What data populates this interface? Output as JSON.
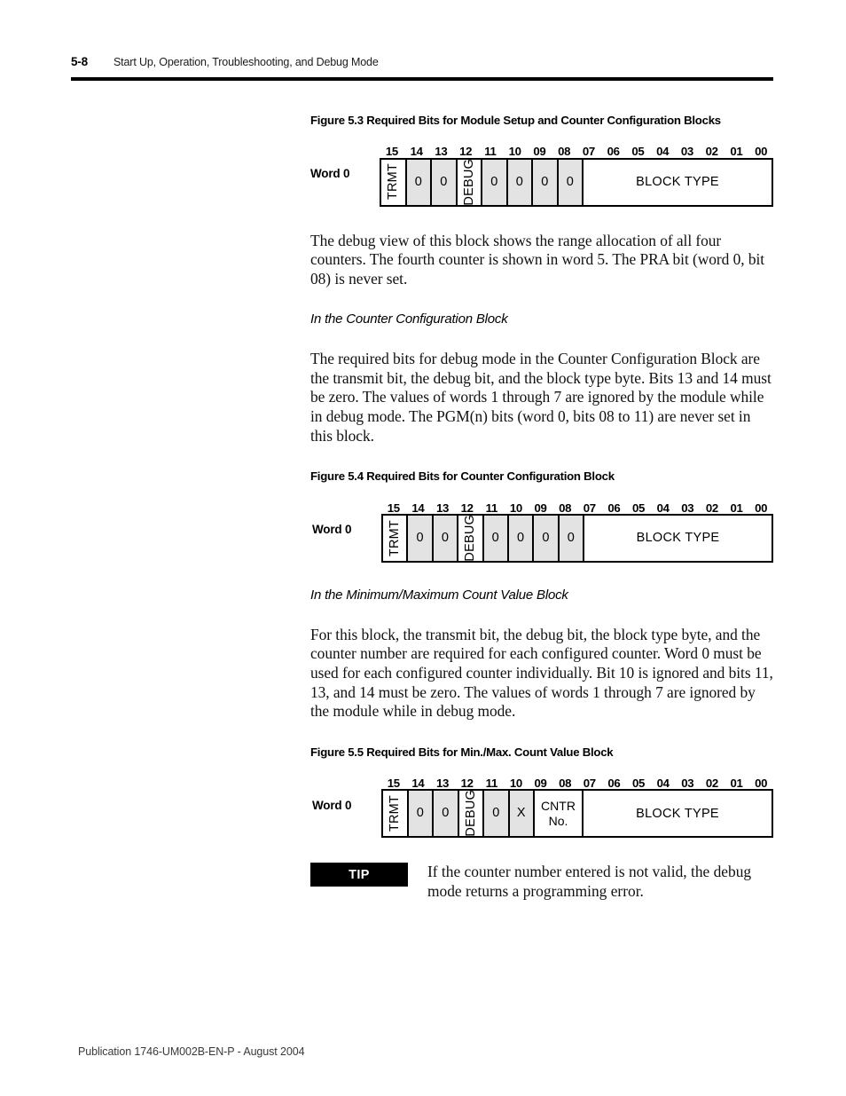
{
  "page": {
    "folio": "5-8",
    "header_title": "Start Up, Operation, Troubleshooting, and Debug Mode",
    "footer": "Publication 1746-UM002B-EN-P - August 2004"
  },
  "bit_labels": [
    "15",
    "14",
    "13",
    "12",
    "11",
    "10",
    "09",
    "08",
    "07",
    "06",
    "05",
    "04",
    "03",
    "02",
    "01",
    "00"
  ],
  "figures": {
    "f53": {
      "caption": "Figure 5.3 Required Bits for Module Setup and Counter Configuration Blocks",
      "word_label": "Word 0",
      "cells": [
        {
          "text": "TRMT",
          "style": "vert",
          "shaded": false,
          "span": 1
        },
        {
          "text": "0",
          "style": "flat",
          "shaded": true,
          "span": 1
        },
        {
          "text": "0",
          "style": "flat",
          "shaded": true,
          "span": 1
        },
        {
          "text": "DEBUG",
          "style": "vert",
          "shaded": false,
          "span": 1
        },
        {
          "text": "0",
          "style": "flat",
          "shaded": true,
          "span": 1
        },
        {
          "text": "0",
          "style": "flat",
          "shaded": true,
          "span": 1
        },
        {
          "text": "0",
          "style": "flat",
          "shaded": true,
          "span": 1
        },
        {
          "text": "0",
          "style": "flat",
          "shaded": true,
          "span": 1
        },
        {
          "text": "BLOCK TYPE",
          "style": "wide",
          "shaded": false,
          "span": 8
        }
      ]
    },
    "f54": {
      "caption": "Figure 5.4 Required Bits for Counter Configuration Block",
      "word_label": "Word 0",
      "cells": [
        {
          "text": "TRMT",
          "style": "vert",
          "shaded": false,
          "span": 1
        },
        {
          "text": "0",
          "style": "flat",
          "shaded": true,
          "span": 1
        },
        {
          "text": "0",
          "style": "flat",
          "shaded": true,
          "span": 1
        },
        {
          "text": "DEBUG",
          "style": "vert",
          "shaded": false,
          "span": 1
        },
        {
          "text": "0",
          "style": "flat",
          "shaded": true,
          "span": 1
        },
        {
          "text": "0",
          "style": "flat",
          "shaded": true,
          "span": 1
        },
        {
          "text": "0",
          "style": "flat",
          "shaded": true,
          "span": 1
        },
        {
          "text": "0",
          "style": "flat",
          "shaded": true,
          "span": 1
        },
        {
          "text": "BLOCK TYPE",
          "style": "wide",
          "shaded": false,
          "span": 8
        }
      ]
    },
    "f55": {
      "caption": "Figure 5.5 Required Bits for Min./Max. Count Value Block",
      "word_label": "Word 0",
      "cells": [
        {
          "text": "TRMT",
          "style": "vert",
          "shaded": false,
          "span": 1
        },
        {
          "text": "0",
          "style": "flat",
          "shaded": true,
          "span": 1
        },
        {
          "text": "0",
          "style": "flat",
          "shaded": true,
          "span": 1
        },
        {
          "text": "DEBUG",
          "style": "vert",
          "shaded": false,
          "span": 1
        },
        {
          "text": "0",
          "style": "flat",
          "shaded": true,
          "span": 1
        },
        {
          "text": "X",
          "style": "flat",
          "shaded": true,
          "span": 1
        },
        {
          "text": "CNTR\nNo.",
          "style": "two-line",
          "shaded": false,
          "span": 2
        },
        {
          "text": "BLOCK TYPE",
          "style": "wide",
          "shaded": false,
          "span": 8
        }
      ]
    }
  },
  "body": {
    "p1": "The debug view of this block shows the range allocation of all four counters. The fourth counter is shown in word 5. The PRA bit (word 0, bit 08) is never set.",
    "subhead1": "In the Counter Configuration Block",
    "p2": "The required bits for debug mode in the Counter Configuration Block are the transmit bit, the debug bit, and the block type byte. Bits 13 and 14 must be zero. The values of words 1 through 7 are ignored by the module while in debug mode. The PGM(n) bits (word 0, bits 08 to 11) are never set in this block.",
    "subhead2": "In the Minimum/Maximum Count Value Block",
    "p3": "For this block, the transmit bit, the debug bit, the block type byte, and the counter number are required for each configured counter. Word 0 must be used for each configured counter individually. Bit 10 is ignored and bits 11, 13, and 14 must be zero. The values of words 1 through 7 are ignored by the module while in debug mode."
  },
  "tip": {
    "badge": "TIP",
    "text": "If the counter number entered is not valid, the debug mode returns a programming error."
  }
}
